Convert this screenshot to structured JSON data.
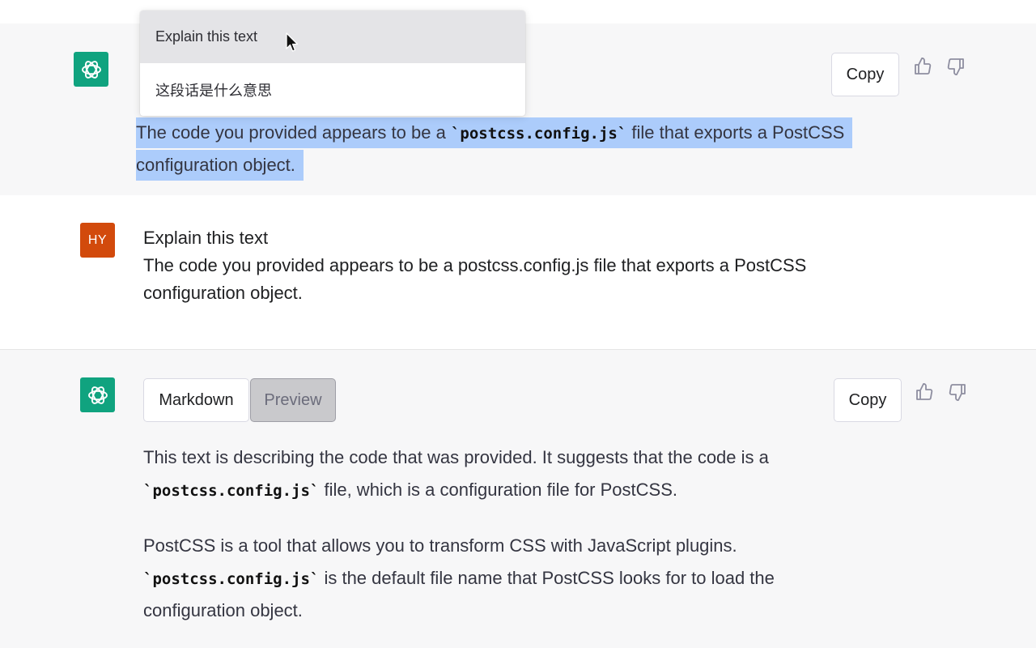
{
  "context_menu": {
    "items": [
      {
        "label": "Explain this text"
      },
      {
        "label": "这段话是什么意思"
      }
    ]
  },
  "assistant_message_1": {
    "copy_label": "Copy",
    "text_before_code": "The code you provided appears to be a ",
    "code": "`postcss.config.js`",
    "text_after_code": " file that exports a PostCSS",
    "line2": "configuration object."
  },
  "user_message": {
    "avatar_initials": "HY",
    "line1": "Explain this text",
    "line2": "The code you provided appears to be a postcss.config.js file that exports a PostCSS",
    "line3": "configuration object."
  },
  "assistant_message_2": {
    "markdown_label": "Markdown",
    "preview_label": "Preview",
    "copy_label": "Copy",
    "p1_line1": "This text is describing the code that was provided. It suggests that the code is a",
    "p1_code": "`postcss.config.js`",
    "p1_line2_rest": " file, which is a configuration file for PostCSS.",
    "p2_line1": "PostCSS is a tool that allows you to transform CSS with JavaScript plugins.",
    "p2_code": "`postcss.config.js`",
    "p2_line2_rest": " is the default file name that PostCSS looks for to load the",
    "p2_line3": "configuration object."
  },
  "icons": {
    "assistant_avatar": "openai-logo-icon",
    "thumbs_up": "thumbs-up-icon",
    "thumbs_down": "thumbs-down-icon",
    "pointer": "mouse-cursor-icon"
  },
  "colors": {
    "assistant_avatar_bg": "#10a37f",
    "user_avatar_bg": "#d24a0c",
    "selection": "#acccfb",
    "alt_background": "#f7f7f8"
  }
}
